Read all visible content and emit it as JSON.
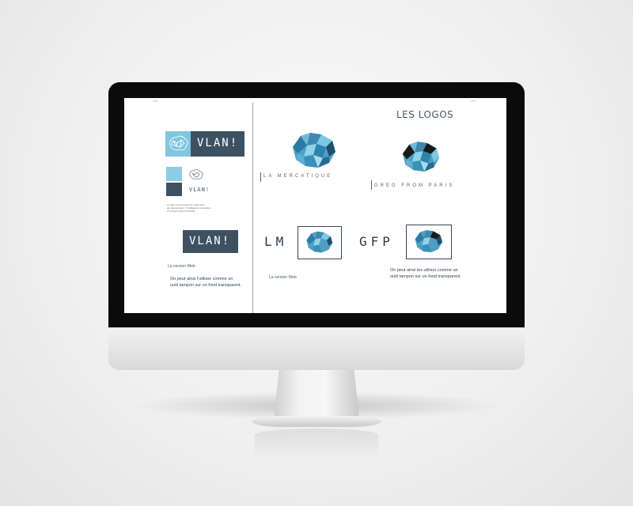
{
  "left_page": {
    "brand_logo_text": "VLAN!",
    "mini_logo_text": "VLAN!",
    "caption_lines": [
      "Le logo est composé de 4 éléments",
      "qui représentent : l'intelligence numérique",
      "et l'univers avec l'humanité"
    ],
    "web_logo_text": "VLAN!",
    "web_label": "La version Web",
    "web_desc_line1": "On peut ainsi l'utiliser comme un",
    "web_desc_line2": "outil tampon sur un fond transparent."
  },
  "right_page": {
    "title": "LES LOGOS",
    "logo1_wordmark": "LA MERCATIQUE",
    "logo2_wordmark": "GREG FROM PARIS",
    "monogram1": "LM",
    "monogram2": "GFP",
    "web_label": "La version Web",
    "desc_line1": "On peut ainsi les utiliser comme un",
    "desc_line2": "outil tampon sur un fond transparent."
  },
  "colors": {
    "dark_slate": "#3d5163",
    "light_blue": "#8ccde4",
    "page_bg": "#ffffff"
  }
}
